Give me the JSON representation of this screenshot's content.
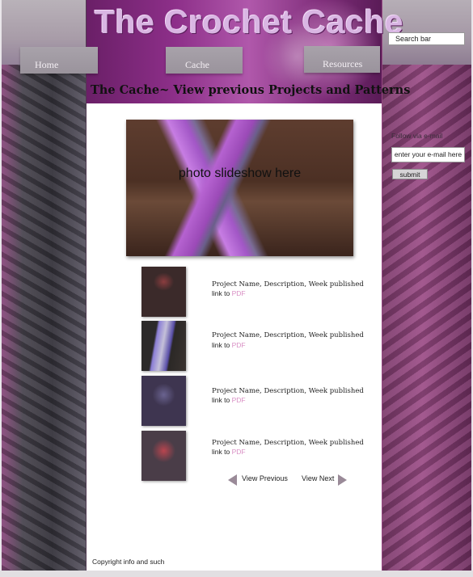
{
  "header": {
    "site_title": "The Crochet Cache",
    "subtitle": "The Cache~ View previous Projects and Patterns",
    "search_placeholder": "Search bar"
  },
  "nav": {
    "items": [
      {
        "label": "Home"
      },
      {
        "label": "Cache"
      },
      {
        "label": "Resources"
      }
    ]
  },
  "main": {
    "slideshow_label": "photo slideshow here",
    "projects": [
      {
        "description": "Project Name, Description, Week published",
        "link_prefix": "link to",
        "link_label": "PDF"
      },
      {
        "description": "Project Name, Description, Week published",
        "link_prefix": "link to",
        "link_label": "PDF"
      },
      {
        "description": "Project Name, Description, Week published",
        "link_prefix": "link to",
        "link_label": "PDF"
      },
      {
        "description": "Project Name, Description, Week published",
        "link_prefix": "link to",
        "link_label": "PDF"
      }
    ],
    "pager": {
      "previous": "View Previous",
      "next": "View Next"
    },
    "footer": "Copyright info and such"
  },
  "sidebar": {
    "follow_label": "Follow via e-mail",
    "email_placeholder": "enter your e-mail here",
    "submit_label": "submit"
  },
  "colors": {
    "link": "#d98fc4",
    "banner_purple": "#8d2f89"
  }
}
